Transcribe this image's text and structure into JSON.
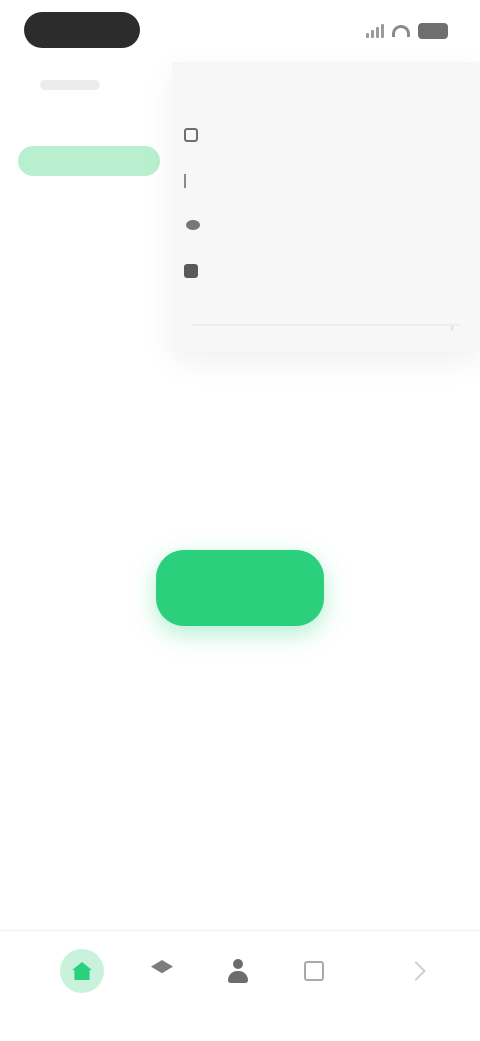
{
  "status_bar": {
    "time": "",
    "signal_icon": "signal-icon",
    "wifi_icon": "wifi-icon",
    "battery_icon": "battery-icon"
  },
  "side_nav": {
    "section_label": "",
    "active_item_label": ""
  },
  "menu": {
    "header": "",
    "items": [
      {
        "label": "",
        "icon": "square-icon"
      },
      {
        "label": "",
        "icon": "edit-icon"
      },
      {
        "label": "",
        "icon": "dot-icon"
      },
      {
        "label": "",
        "icon": "grid-icon"
      }
    ],
    "chevron": "›"
  },
  "primary": {
    "caption": "",
    "button_label": ""
  },
  "bottom_nav": {
    "tabs": [
      {
        "label": "",
        "icon": "home-icon",
        "active": true
      },
      {
        "label": "",
        "icon": "stack-icon",
        "active": false
      },
      {
        "label": "",
        "icon": "profile-icon",
        "active": false
      },
      {
        "label": "",
        "icon": "grid-icon",
        "active": false
      },
      {
        "label": "",
        "icon": "chevron-right-icon",
        "active": false
      }
    ]
  },
  "colors": {
    "accent": "#2bd07d",
    "accent_soft": "#c9f2dc",
    "menu_bg": "#f7f7f7",
    "pill": "#2c2c2c"
  }
}
